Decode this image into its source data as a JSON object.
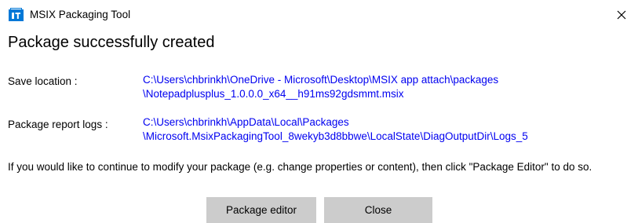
{
  "window": {
    "title": "MSIX Packaging Tool",
    "close_icon": "close-icon",
    "app_icon": "msix-app-icon",
    "accent_color": "#0078d7"
  },
  "heading": "Package successfully created",
  "save_location": {
    "label": "Save location :",
    "line1": "C:\\Users\\chbrinkh\\OneDrive - Microsoft\\Desktop\\MSIX app attach\\packages",
    "line2": "\\Notepadplusplus_1.0.0.0_x64__h91ms92gdsmmt.msix"
  },
  "report_logs": {
    "label": "Package report logs :",
    "line1": "C:\\Users\\chbrinkh\\AppData\\Local\\Packages",
    "line2": "\\Microsoft.MsixPackagingTool_8wekyb3d8bbwe\\LocalState\\DiagOutputDir\\Logs_5"
  },
  "info_text": "If you would like to continue to modify your package (e.g. change properties or content), then click \"Package Editor\" to do so.",
  "buttons": {
    "editor_label": "Package editor",
    "close_label": "Close"
  },
  "colors": {
    "link": "#0000f0",
    "button_bg": "#cccccc"
  }
}
